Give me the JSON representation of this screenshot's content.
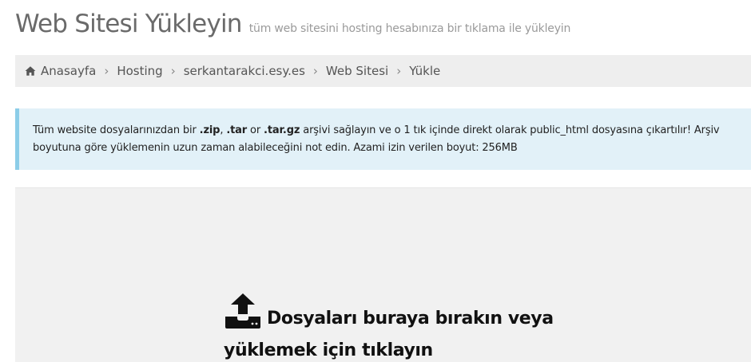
{
  "header": {
    "title": "Web Sitesi Yükleyin",
    "subtitle": "tüm web sitesini hosting hesabınıza bir tıklama ile yükleyin"
  },
  "breadcrumb": {
    "home_icon": "home-icon",
    "items": [
      {
        "label": "Anasayfa"
      },
      {
        "label": "Hosting"
      },
      {
        "label": "serkantarakci.esy.es"
      },
      {
        "label": "Web Sitesi"
      },
      {
        "label": "Yükle"
      }
    ],
    "separator": "›"
  },
  "alert": {
    "text_1": "Tüm website dosyalarınızdan bir ",
    "ext_zip": ".zip",
    "text_2": ", ",
    "ext_tar": ".tar",
    "text_3": " or ",
    "ext_targz": ".tar.gz",
    "text_4": " arşivi sağlayın ve o 1 tık içinde direkt olarak public_html dosyasına çıkartılır! Arşiv boyutuna göre yüklemenin uzun zaman alabileceğini not edin. Azami izin verilen boyut: 256MB",
    "accent_color": "#8ccde8",
    "background_color": "#e2f1f8"
  },
  "dropzone": {
    "icon": "upload-icon",
    "message": "Dosyaları buraya bırakın veya yüklemek için tıklayın"
  }
}
